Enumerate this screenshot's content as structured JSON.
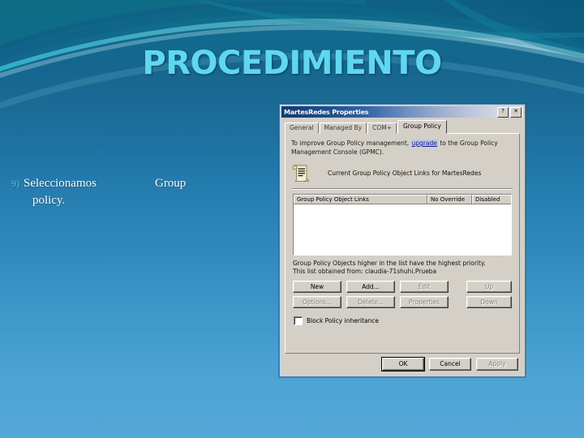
{
  "slide": {
    "title": "PROCEDIMIENTO",
    "bullet": {
      "number": "9)",
      "text_part1": "Seleccionamos",
      "text_part2": "Group",
      "text_part3": "policy."
    },
    "colors": {
      "title_color": "#5fd7f0",
      "bg_top": "#0f6d86",
      "bg_bottom": "#54a8d8",
      "bullet_number": "#63c8d8",
      "bullet_text": "#ffffff"
    }
  },
  "dialog": {
    "title": "MartesRedes Properties",
    "titlebar_buttons": [
      {
        "name": "help",
        "glyph": "?"
      },
      {
        "name": "close",
        "glyph": "✕"
      }
    ],
    "tabs": [
      {
        "label": "General",
        "active": false
      },
      {
        "label": "Managed By",
        "active": false
      },
      {
        "label": "COM+",
        "active": false
      },
      {
        "label": "Group Policy",
        "active": true
      }
    ],
    "intro": {
      "before_link": "To improve Group Policy management,",
      "link": "upgrade",
      "after_link": "to the Group Policy Management Console (GPMC)."
    },
    "current_links_label": "Current Group Policy Object Links for MartesRedes",
    "icon": "group-policy-scroll-icon",
    "list": {
      "columns": [
        "Group Policy Object Links",
        "No Override",
        "Disabled"
      ],
      "rows": []
    },
    "note_line1": "Group Policy Objects higher in the list have the highest priority.",
    "note_line2": "This list obtained from: claudia-71shuhi.Prueba",
    "buttons": [
      {
        "label": "New",
        "disabled": false
      },
      {
        "label": "Add...",
        "disabled": false
      },
      {
        "label": "Edit",
        "disabled": true
      },
      {
        "label": "Up",
        "disabled": true
      },
      {
        "label": "Options...",
        "disabled": true
      },
      {
        "label": "Delete...",
        "disabled": true
      },
      {
        "label": "Properties",
        "disabled": true
      },
      {
        "label": "Down",
        "disabled": true
      }
    ],
    "checkbox": {
      "label": "Block Policy inheritance",
      "checked": false
    },
    "footer": [
      {
        "label": "OK",
        "disabled": false,
        "default": true
      },
      {
        "label": "Cancel",
        "disabled": false,
        "default": false
      },
      {
        "label": "Apply",
        "disabled": true,
        "default": false
      }
    ]
  }
}
